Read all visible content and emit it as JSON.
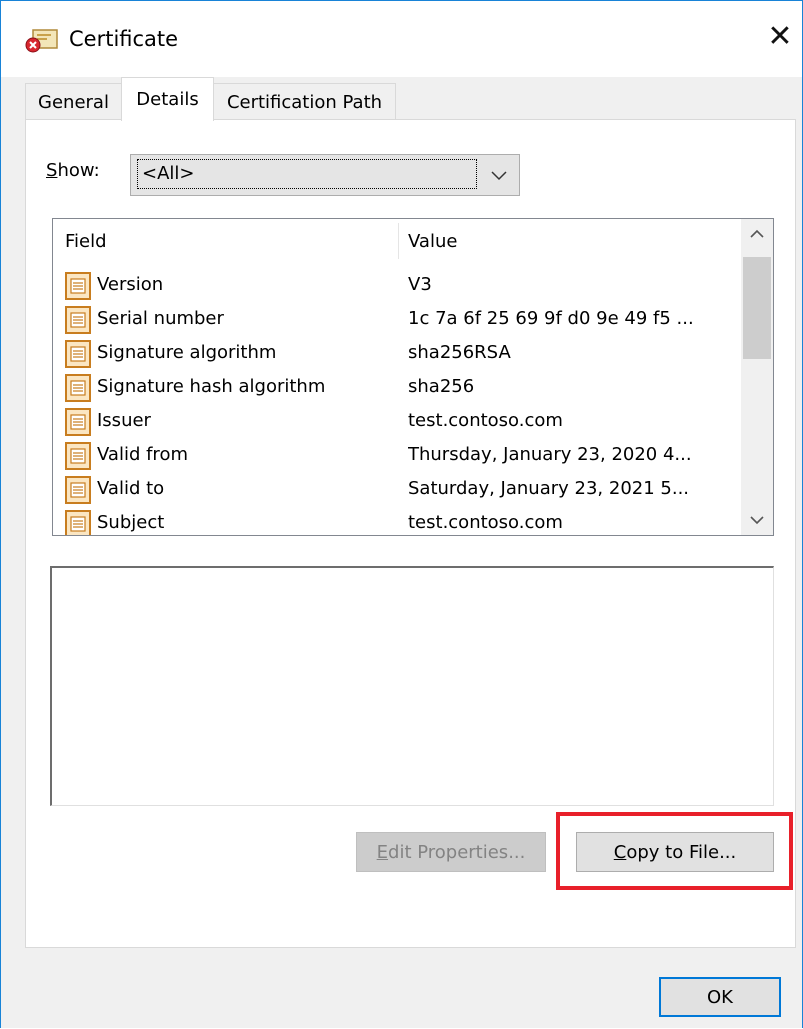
{
  "window": {
    "title": "Certificate",
    "close_glyph": "✕"
  },
  "tabs": [
    {
      "label": "General",
      "active": false
    },
    {
      "label": "Details",
      "active": true
    },
    {
      "label": "Certification Path",
      "active": false
    }
  ],
  "show": {
    "label_access": "S",
    "label_rest": "how:",
    "selected": "<All>"
  },
  "list": {
    "columns": [
      "Field",
      "Value"
    ],
    "rows": [
      {
        "field": "Version",
        "value": "V3"
      },
      {
        "field": "Serial number",
        "value": "1c 7a 6f 25 69 9f d0 9e 49 f5 ..."
      },
      {
        "field": "Signature algorithm",
        "value": "sha256RSA"
      },
      {
        "field": "Signature hash algorithm",
        "value": "sha256"
      },
      {
        "field": "Issuer",
        "value": "test.contoso.com"
      },
      {
        "field": "Valid from",
        "value": "Thursday, January 23, 2020 4..."
      },
      {
        "field": "Valid to",
        "value": "Saturday, January 23, 2021 5..."
      },
      {
        "field": "Subject",
        "value": "test.contoso.com"
      }
    ]
  },
  "buttons": {
    "edit_access": "E",
    "edit_rest": "dit Properties...",
    "copy_access": "C",
    "copy_rest": "opy to File...",
    "ok": "OK"
  },
  "colors": {
    "highlight": "#e8202a",
    "focus_border": "#0078d7",
    "window_border": "#1883d7"
  }
}
